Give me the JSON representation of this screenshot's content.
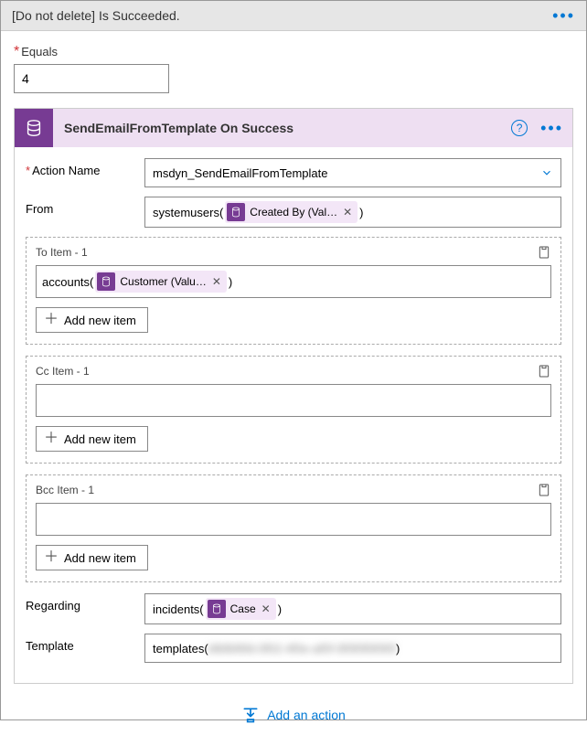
{
  "header": {
    "title": "[Do not delete] Is Succeeded."
  },
  "equals": {
    "label": "Equals",
    "value": "4"
  },
  "card": {
    "title": "SendEmailFromTemplate On Success",
    "actionName": {
      "label": "Action Name",
      "value": "msdyn_SendEmailFromTemplate"
    },
    "from": {
      "label": "From",
      "prefix": "systemusers(",
      "token": "Created By (Val…",
      "suffix": ")"
    },
    "to": {
      "label": "To Item - 1",
      "prefix": "accounts(",
      "token": "Customer (Valu…",
      "suffix": ")",
      "add": "Add new item"
    },
    "cc": {
      "label": "Cc Item - 1",
      "add": "Add new item"
    },
    "bcc": {
      "label": "Bcc Item - 1",
      "add": "Add new item"
    },
    "regarding": {
      "label": "Regarding",
      "prefix": "incidents(",
      "token": "Case",
      "suffix": ")"
    },
    "template": {
      "label": "Template",
      "prefix": "templates(",
      "blurred": "bfbfbf6fd-0f02-4f0e-af0f-0f0f0f0f0f0f",
      "suffix": ")"
    }
  },
  "footer": {
    "addAction": "Add an action"
  }
}
